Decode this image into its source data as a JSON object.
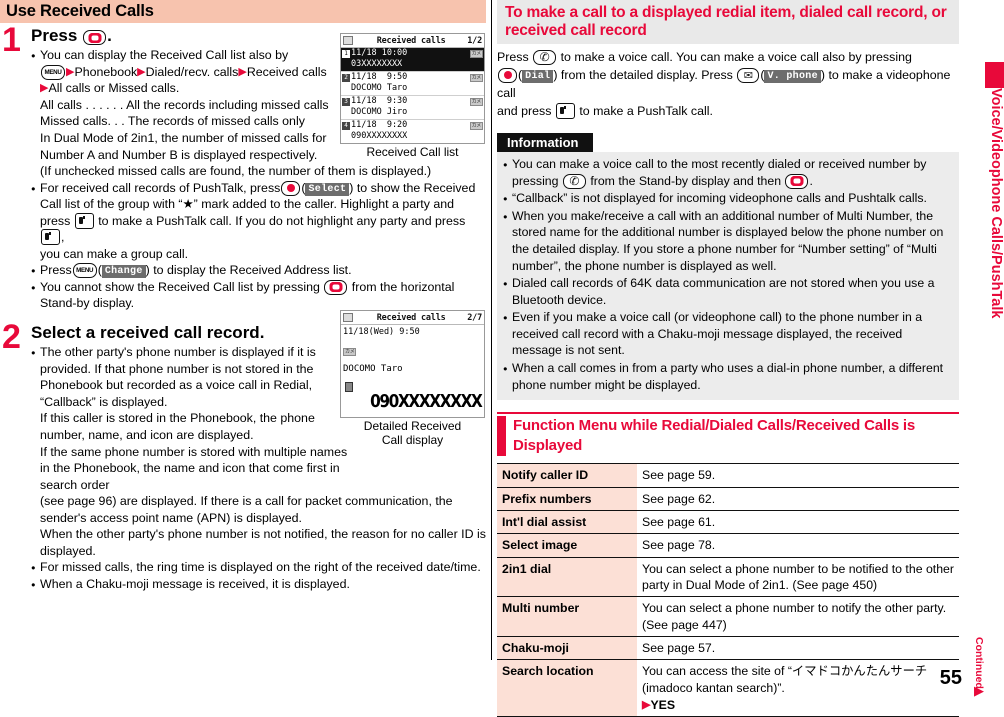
{
  "page_number": "55",
  "continued_label": "Continued",
  "vertical_tab": "Voice/Videophone Calls/PushTalk",
  "colors": {
    "accent_red": "#e8093a",
    "band_peach": "#f7c3ae",
    "table_key_bg": "#fce0d6",
    "info_bg": "#ececec"
  },
  "left": {
    "section_title": "Use Received Calls",
    "step1": {
      "number": "1",
      "heading_prefix": "Press",
      "heading_suffix": ".",
      "bullets": [
        {
          "lines": [
            "You can display the Received Call list also by",
            "Phonebook",
            "Dialed/recv. calls",
            "Received calls",
            "All calls or Missed calls.",
            "All calls . . . . . . All the records including missed calls",
            "Missed calls. . . The records of missed calls only",
            "In Dual Mode of 2in1, the number of missed calls for",
            "Number A and Number B is displayed respectively.",
            "(If unchecked missed calls are found, the number of them is displayed.)"
          ]
        },
        {
          "lines": [
            "For received call records of PushTalk, press",
            "Select",
            ") to show the Received",
            "Call list of the group with “★” mark added to the caller. Highlight a party and",
            "press",
            "to make a PushTalk call. If you do not highlight any party and press",
            ",",
            "you can make a group call."
          ]
        },
        {
          "lines": [
            "Press",
            "Change",
            ") to display the Received Address list."
          ]
        },
        {
          "lines": [
            "You cannot show the Received Call list by pressing",
            "from the horizontal",
            "Stand-by display."
          ]
        }
      ],
      "figure": {
        "title": "Received calls",
        "pager": "1/2",
        "caption": "Received Call list",
        "rows": [
          {
            "index": "1",
            "date": "11/18 10:00",
            "badge": "カメ",
            "number": "03XXXXXXXX",
            "selected": true
          },
          {
            "index": "2",
            "date": "11/18  9:50",
            "badge": "カメ",
            "number": "DOCOMO Taro",
            "selected": false
          },
          {
            "index": "3",
            "date": "11/18  9:30",
            "badge": "カメ",
            "number": "DOCOMO Jiro",
            "selected": false
          },
          {
            "index": "4",
            "date": "11/18  9:20",
            "badge": "カメ",
            "number": "090XXXXXXXX",
            "selected": false
          }
        ]
      }
    },
    "step2": {
      "number": "2",
      "heading": "Select a received call record.",
      "bullets": [
        {
          "lines": [
            "The other party's phone number is displayed if it is",
            "provided. If that phone number is not stored in the",
            "Phonebook but recorded as a voice call in Redial,",
            "“Callback” is displayed.",
            "If this caller is stored in the Phonebook, the phone",
            "number, name, and icon are displayed.",
            "If the same phone number is stored with multiple names",
            "in the Phonebook, the name and icon that come first in",
            "search order",
            "(see page 96) are displayed. If there is a call for packet communication, the",
            "sender's access point name (APN) is displayed.",
            "When the other party's phone number is not notified, the reason for no caller ID is",
            "displayed."
          ]
        },
        {
          "lines": [
            "For missed calls, the ring time is displayed on the right of the received date/time."
          ]
        },
        {
          "lines": [
            "When a Chaku-moji message is received, it is displayed."
          ]
        }
      ],
      "figure": {
        "title": "Received calls",
        "pager": "2/7",
        "caption_line1": "Detailed Received",
        "caption_line2": "Call display",
        "datetime": "11/18(Wed)  9:50",
        "badge": "カメ",
        "name": "DOCOMO Taro",
        "number": "090XXXXXXXX"
      }
    }
  },
  "right": {
    "header": "To make a call to a displayed redial item, dialed call record, or received call record",
    "intro": {
      "seg1": "Press",
      "seg2": "to make a voice call. You can make a voice call also by pressing",
      "softkey_dial": "Dial",
      "seg3": ") from the detailed display. Press",
      "softkey_vphone": "V. phone",
      "seg4": ") to make a videophone call",
      "seg5": "and press",
      "seg6": "to make a PushTalk call."
    },
    "information": {
      "label": "Information",
      "bullets": [
        "You can make a voice call to the most recently dialed or received number by pressing ( ) from the Stand-by display and then ( ).",
        "“Callback” is not displayed for incoming videophone calls and Pushtalk calls.",
        "When you make/receive a call with an additional number of Multi Number, the stored name for the additional number is displayed below the phone number on the detailed display. If you store a phone number for “Number setting” of “Multi number”, the phone number is displayed as well.",
        "Dialed call records of 64K data communication are not stored when you use a Bluetooth device.",
        "Even if you make a voice call (or videophone call) to the phone number in a received call record with a Chaku-moji message displayed, the received message is not sent.",
        "When a call comes in from a party who uses a dial-in phone number, a different phone number might be displayed."
      ],
      "bullet1_parts": {
        "a": "You can make a voice call to the most recently dialed or received number by pressing",
        "b": "from the Stand-by display and then",
        "c": "."
      }
    },
    "function_menu": {
      "title": "Function Menu while Redial/Dialed Calls/Received Calls is Displayed",
      "rows": [
        {
          "key": "Notify caller ID",
          "value": "See page 59."
        },
        {
          "key": "Prefix numbers",
          "value": "See page 62."
        },
        {
          "key": "Int'l dial assist",
          "value": "See page 61."
        },
        {
          "key": "Select image",
          "value": "See page 78."
        },
        {
          "key": "2in1 dial",
          "value": "You can select a phone number to be notified to the other party in Dual Mode of 2in1. (See page 450)"
        },
        {
          "key": "Multi number",
          "value": "You can select a phone number to notify the other party. (See page 447)"
        },
        {
          "key": "Chaku-moji",
          "value": "See page 57."
        },
        {
          "key": "Search location",
          "value": "You can access the site of “イマドコかんたんサーチ (imadoco kantan search)”.",
          "extra": "YES"
        }
      ]
    }
  }
}
